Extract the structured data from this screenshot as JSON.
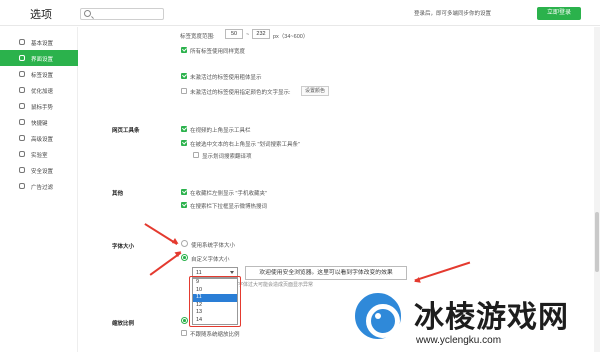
{
  "app": {
    "title": "选项",
    "search_placeholder": ""
  },
  "header": {
    "login_tip": "登录后，即可多端同步你的设置",
    "login_button": "立即登录"
  },
  "sidebar": {
    "items": [
      {
        "label": "基本设置",
        "icon": "settings-icon",
        "active": false
      },
      {
        "label": "界面设置",
        "icon": "window-icon",
        "active": true
      },
      {
        "label": "标签设置",
        "icon": "tab-icon",
        "active": false
      },
      {
        "label": "优化加速",
        "icon": "rocket-icon",
        "active": false
      },
      {
        "label": "鼠标手势",
        "icon": "mouse-icon",
        "active": false
      },
      {
        "label": "快捷键",
        "icon": "keyboard-icon",
        "active": false
      },
      {
        "label": "高级设置",
        "icon": "advanced-icon",
        "active": false
      },
      {
        "label": "实验室",
        "icon": "lab-icon",
        "active": false
      },
      {
        "label": "安全设置",
        "icon": "shield-icon",
        "active": false
      },
      {
        "label": "广告过滤",
        "icon": "block-icon",
        "active": false
      }
    ]
  },
  "tab_settings": {
    "width_label": "标签宽度范围:",
    "width_min": "50",
    "width_sep": "~",
    "width_max": "232",
    "width_hint": "px（34~600）",
    "same_width": "所有标签使用同样宽度",
    "unread_bold": "未激活过的标签使用粗体显示",
    "unread_color": "未激活过的标签使用指定颜色的文字显示:",
    "color_button": "设置颜色"
  },
  "toolbar_section": {
    "title": "网页工具条",
    "show_toolbar": "在视频的上角显示工具栏",
    "show_search_tool": "在被选中文本的右上角显示 \"划词搜索工具条\"",
    "show_translate": "显示划词搜索翻译项"
  },
  "other_section": {
    "title": "其他",
    "show_favorites": "在收藏栏左侧显示 \"手机收藏夹\"",
    "show_hot_search": "在搜索栏下拉框显示微博热搜词"
  },
  "font_section": {
    "title": "字体大小",
    "system_font": "使用系统字体大小",
    "custom_font": "自定义字体大小",
    "current_size": "11",
    "preview_text": "欢迎使用安全浏览器。这里可以看到字体改变的效果",
    "hint": "字体过大可能会造成页面显示异常",
    "options": [
      "9",
      "10",
      "11",
      "12",
      "13",
      "14"
    ],
    "selected_option": "11"
  },
  "zoom_section": {
    "title": "缩放比例",
    "system_zoom": "不跟随系统缩放比例"
  },
  "watermark": {
    "text": "冰棱游戏网",
    "url": "www.yclengku.com"
  }
}
